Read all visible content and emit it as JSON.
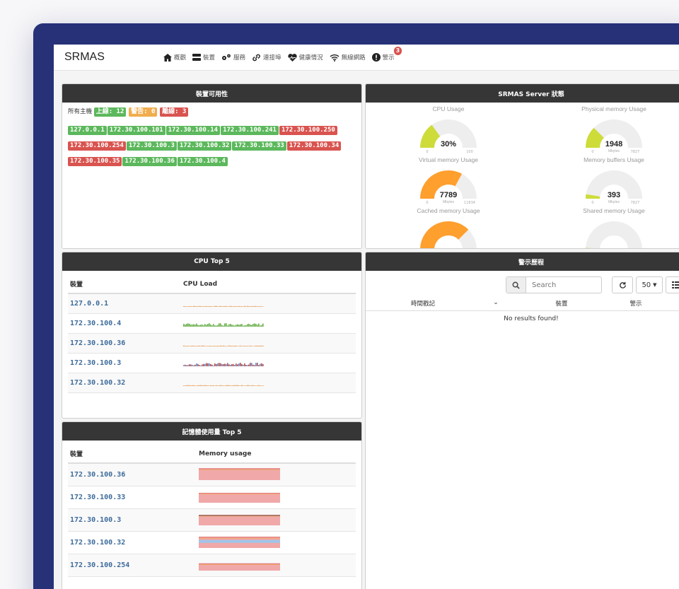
{
  "app": {
    "brand": "SRMAS"
  },
  "nav": [
    {
      "icon": "home-icon",
      "label": "概觀"
    },
    {
      "icon": "server-icon",
      "label": "裝置"
    },
    {
      "icon": "gears-icon",
      "label": "服務"
    },
    {
      "icon": "link-icon",
      "label": "連接埠"
    },
    {
      "icon": "heartbeat-icon",
      "label": "健康情況"
    },
    {
      "icon": "wifi-icon",
      "label": "無線網路"
    },
    {
      "icon": "alert-icon",
      "label": "警示",
      "badge": "3"
    }
  ],
  "availability": {
    "title": "裝置可用性",
    "all_hosts": "所有主機",
    "up": "上線: 12",
    "warn": "警告: 0",
    "down": "離線: 3",
    "hosts": [
      {
        "ip": "127.0.0.1",
        "status": "up"
      },
      {
        "ip": "172.30.100.101",
        "status": "up"
      },
      {
        "ip": "172.30.100.14",
        "status": "up"
      },
      {
        "ip": "172.30.100.241",
        "status": "up"
      },
      {
        "ip": "172.30.100.250",
        "status": "down"
      },
      {
        "ip": "172.30.100.254",
        "status": "down"
      },
      {
        "ip": "172.30.100.3",
        "status": "up"
      },
      {
        "ip": "172.30.100.32",
        "status": "up"
      },
      {
        "ip": "172.30.100.33",
        "status": "up"
      },
      {
        "ip": "172.30.100.34",
        "status": "down"
      },
      {
        "ip": "172.30.100.35",
        "status": "down"
      },
      {
        "ip": "172.30.100.36",
        "status": "up"
      },
      {
        "ip": "172.30.100.4",
        "status": "up"
      }
    ]
  },
  "server": {
    "title": "SRMAS Server 狀態",
    "gauges": [
      {
        "title": "CPU Usage",
        "value": "30%",
        "min": "0",
        "max": "100",
        "unit": "",
        "fraction": 0.3,
        "color": "#cddc39"
      },
      {
        "title": "Physical memory Usage",
        "value": "1948",
        "min": "0",
        "max": "7827",
        "unit": "Mbytes",
        "fraction": 0.249,
        "color": "#cddc39"
      },
      {
        "title": "Virtual memory Usage",
        "value": "7789",
        "min": "0",
        "max": "11834",
        "unit": "Mbytes",
        "fraction": 0.658,
        "color": "#ff9f2d"
      },
      {
        "title": "Memory buffers Usage",
        "value": "393",
        "min": "0",
        "max": "7827",
        "unit": "Mbytes",
        "fraction": 0.05,
        "color": "#cddc39"
      },
      {
        "title": "Cached memory Usage",
        "value": "",
        "min": "",
        "max": "",
        "unit": "",
        "fraction": 0.75,
        "color": "#ff9f2d"
      },
      {
        "title": "Shared memory Usage",
        "value": "",
        "min": "",
        "max": "",
        "unit": "",
        "fraction": 0.02,
        "color": "#cddc39"
      }
    ]
  },
  "cpu_top": {
    "title": "CPU Top 5",
    "col_device": "裝置",
    "col_load": "CPU Load",
    "rows": [
      {
        "host": "127.0.0.1",
        "color": "#e8a060"
      },
      {
        "host": "172.30.100.4",
        "color": "#6ab04c"
      },
      {
        "host": "172.30.100.36",
        "color": "#e8a060"
      },
      {
        "host": "172.30.100.3",
        "color": "#b05050"
      },
      {
        "host": "172.30.100.32",
        "color": "#e8a060"
      }
    ]
  },
  "mem_top": {
    "title": "記憶體使用量 Top 5",
    "col_device": "裝置",
    "col_usage": "Memory usage",
    "rows": [
      {
        "host": "172.30.100.36",
        "fill": 0.9
      },
      {
        "host": "172.30.100.33",
        "fill": 0.75
      },
      {
        "host": "172.30.100.3",
        "fill": 0.8
      },
      {
        "host": "172.30.100.32",
        "fill": 0.85
      },
      {
        "host": "172.30.100.254",
        "fill": 0.55
      }
    ]
  },
  "alerts": {
    "title": "警示歷程",
    "search_placeholder": "Search",
    "page_size": "50",
    "col_time": "時間戳記",
    "col_device": "裝置",
    "col_alert": "警示",
    "empty": "No results found!"
  }
}
